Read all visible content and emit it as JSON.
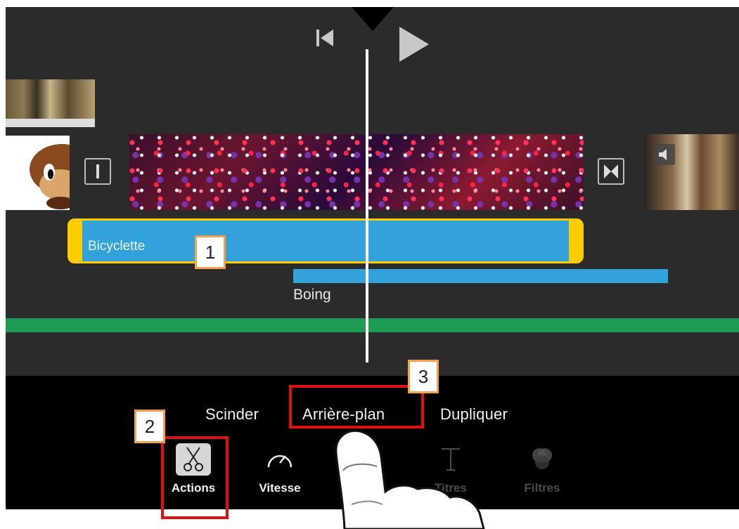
{
  "timeline": {
    "audio_clip_label": "Bicyclette",
    "sfx_label": "Boing"
  },
  "action_menu": {
    "items": [
      "Scinder",
      "Arrière-plan",
      "Dupliquer"
    ]
  },
  "toolbar": {
    "tools": [
      {
        "label": "Actions",
        "icon": "scissors-icon",
        "state": "selected"
      },
      {
        "label": "Vitesse",
        "icon": "speedometer-icon",
        "state": "enabled"
      },
      {
        "label": "Titres",
        "icon": "text-t-icon",
        "state": "disabled"
      },
      {
        "label": "Filtres",
        "icon": "filters-circles-icon",
        "state": "disabled"
      }
    ]
  },
  "callouts": [
    "1",
    "2",
    "3"
  ],
  "colors": {
    "timeline_bg": "#2b2b2b",
    "toolbar_bg": "#000000",
    "clip_blue": "#33a2db",
    "clip_selected_border": "#ffcc00",
    "music_green": "#1e9a55",
    "highlight_red": "#e01010",
    "callout_orange": "#f5a04a"
  }
}
